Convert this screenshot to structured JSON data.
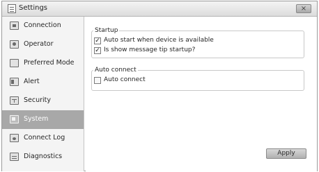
{
  "window": {
    "title": "Settings",
    "close_label": "×",
    "app_icon": "settings-window-icon"
  },
  "sidebar": {
    "items": [
      {
        "label": "Connection",
        "icon": "connection-icon",
        "selected": false
      },
      {
        "label": "Operator",
        "icon": "operator-icon",
        "selected": false
      },
      {
        "label": "Preferred Mode",
        "icon": "preferred-mode-icon",
        "selected": false
      },
      {
        "label": "Alert",
        "icon": "alert-icon",
        "selected": false
      },
      {
        "label": "Security",
        "icon": "security-icon",
        "selected": false
      },
      {
        "label": "System",
        "icon": "system-icon",
        "selected": true
      },
      {
        "label": "Connect Log",
        "icon": "connect-log-icon",
        "selected": false
      },
      {
        "label": "Diagnostics",
        "icon": "diagnostics-icon",
        "selected": false
      }
    ]
  },
  "startup": {
    "title": "Startup",
    "auto_start": {
      "label": "Auto start when device is available",
      "checked": true
    },
    "show_tip": {
      "label": "Is show message tip startup?",
      "checked": true
    }
  },
  "auto_connect": {
    "title": "Auto connect",
    "option": {
      "label": "Auto connect",
      "checked": false
    }
  },
  "apply_label": "Apply",
  "check_mark": "✓",
  "colors": {
    "selected_item_bg": "#a8a8a8",
    "sidebar_bg": "#f4f4f4",
    "titlebar_bg": "#e6e6e6"
  }
}
